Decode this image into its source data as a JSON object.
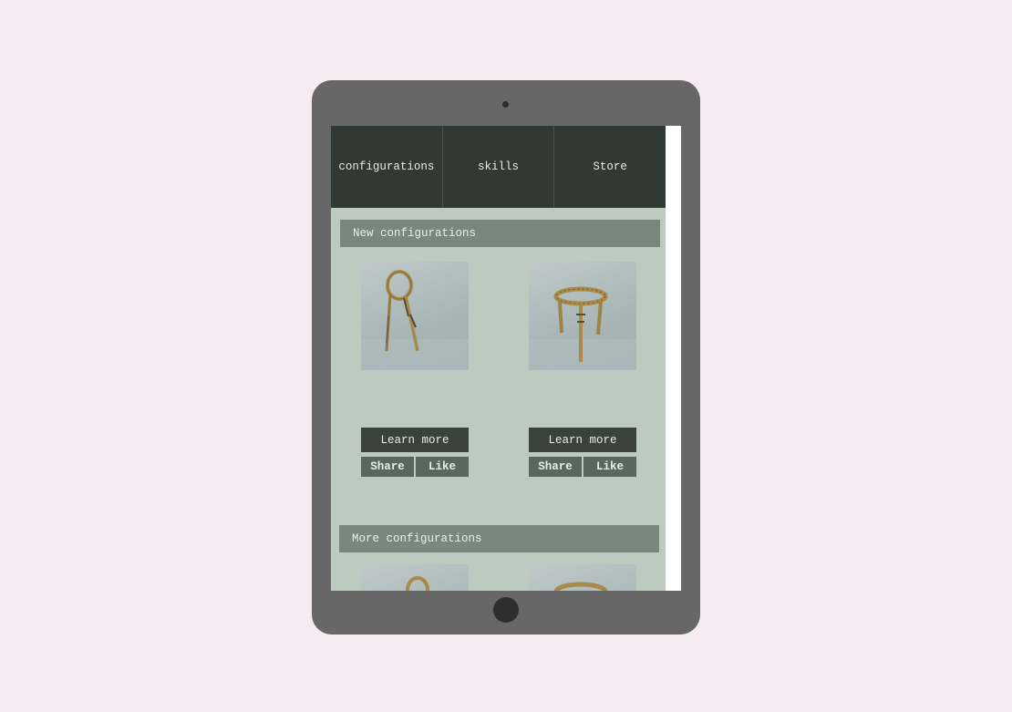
{
  "nav": {
    "items": [
      {
        "label": "configurations"
      },
      {
        "label": "skills"
      },
      {
        "label": "Store"
      }
    ]
  },
  "sections": {
    "new": {
      "title": "New configurations"
    },
    "more": {
      "title": "More configurations"
    }
  },
  "cards": [
    {
      "image": "hoop-leaning-sculpture",
      "learn_more": "Learn more",
      "share": "Share",
      "like": "Like"
    },
    {
      "image": "ring-stool-sculpture",
      "learn_more": "Learn more",
      "share": "Share",
      "like": "Like"
    }
  ],
  "colors": {
    "page_background": "#f6ebf1",
    "device_frame": "#676767",
    "nav_background": "#313935",
    "content_background": "#bccac0",
    "section_header": "#78897c",
    "learn_more_button": "#39433b",
    "action_button": "#58695c"
  }
}
